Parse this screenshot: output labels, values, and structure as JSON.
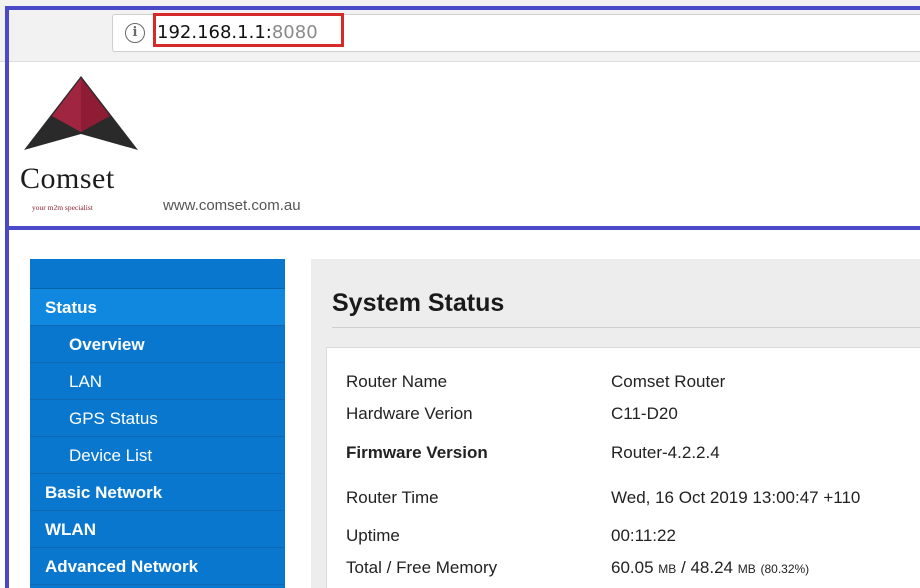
{
  "browser": {
    "info_glyph": "i",
    "url_host": "192.168.1.1:",
    "url_port": "8080"
  },
  "header": {
    "logo_name": "Comset",
    "logo_tagline": "your m2m specialist",
    "site_url": "www.comset.com.au",
    "colors": {
      "logo_red": "#8e1c34",
      "logo_dark": "#2a2a2a",
      "annotation_blue": "#4a4ac8",
      "annotation_red": "#d62a2a"
    }
  },
  "sidebar": {
    "accent": "#0a77cf",
    "items": [
      {
        "label": "Status",
        "level": "head",
        "active": true
      },
      {
        "label": "Overview",
        "level": "sub",
        "active": true
      },
      {
        "label": "LAN",
        "level": "sub",
        "active": false
      },
      {
        "label": "GPS Status",
        "level": "sub",
        "active": false
      },
      {
        "label": "Device List",
        "level": "sub",
        "active": false
      },
      {
        "label": "Basic Network",
        "level": "head",
        "active": false
      },
      {
        "label": "WLAN",
        "level": "head",
        "active": false
      },
      {
        "label": "Advanced Network",
        "level": "head",
        "active": false
      }
    ]
  },
  "main": {
    "title": "System Status",
    "rows": [
      {
        "label": "Router Name",
        "value": "Comset Router"
      },
      {
        "label": "Hardware Verion",
        "value": "C11-D20"
      },
      {
        "label": "Firmware Version",
        "value": "Router-4.2.2.4"
      },
      {
        "label": "Router Time",
        "value": "Wed, 16 Oct 2019 13:00:47 +110"
      },
      {
        "label": "Uptime",
        "value": "00:11:22"
      }
    ],
    "memory": {
      "label": "Total / Free Memory",
      "total": "60.05",
      "total_unit": "MB",
      "separator": " / ",
      "free": "48.24",
      "free_unit": "MB",
      "percent": "(80.32%)"
    }
  }
}
